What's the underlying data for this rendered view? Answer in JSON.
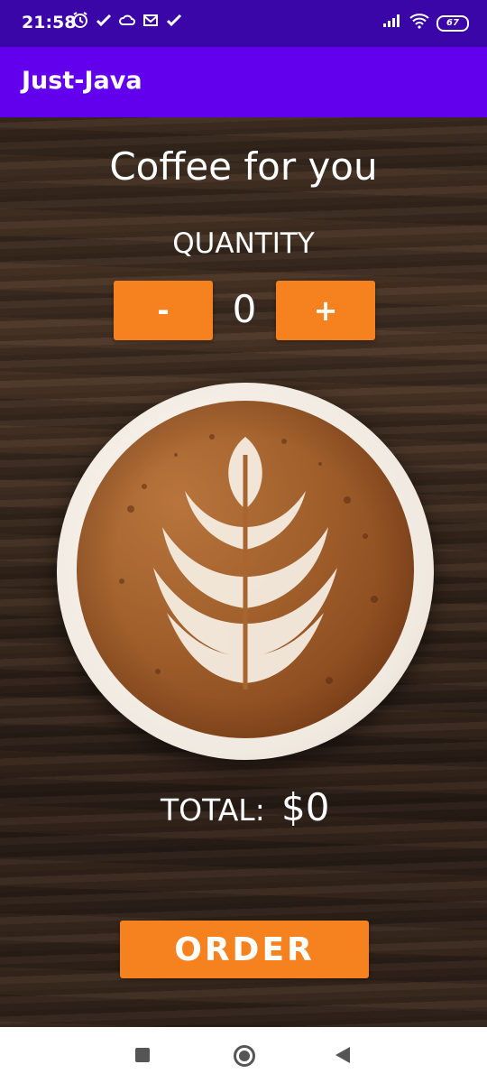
{
  "status_bar": {
    "time": "21:58",
    "battery": "67",
    "left_icons": [
      "alarm-icon",
      "check-icon",
      "cloud-icon",
      "mail-icon",
      "check-icon"
    ],
    "right_icons": [
      "signal-icon",
      "wifi-icon",
      "battery-icon"
    ]
  },
  "app_bar": {
    "title": "Just-Java"
  },
  "main": {
    "headline": "Coffee for you",
    "quantity_label": "QUANTITY",
    "decrement_label": "-",
    "quantity_value": "0",
    "increment_label": "+",
    "total_label": "TOTAL:",
    "total_value": "$0",
    "order_label": "ORDER"
  },
  "colors": {
    "status_bar": "#3a06a8",
    "app_bar": "#6200ee",
    "accent_button": "#f5821f",
    "text": "#ffffff"
  },
  "nav_bar": {
    "icons": [
      "recents-icon",
      "home-icon",
      "back-icon"
    ]
  }
}
